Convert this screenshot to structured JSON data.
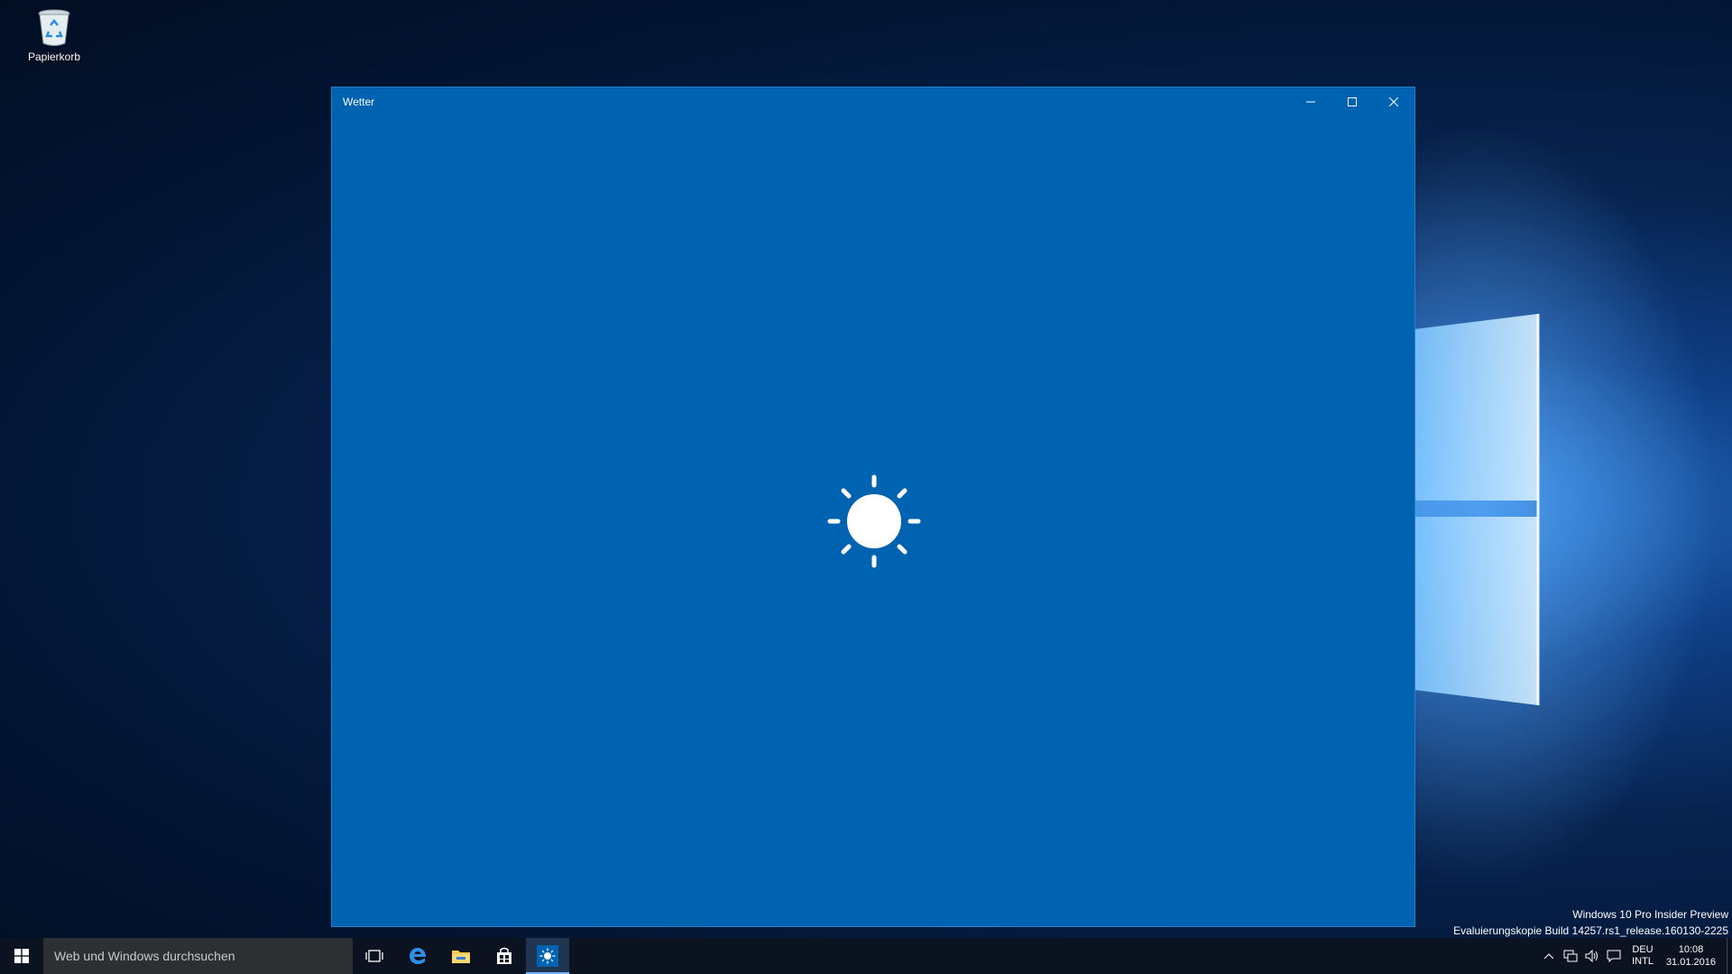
{
  "desktop": {
    "recycle_bin_label": "Papierkorb"
  },
  "window": {
    "title": "Wetter",
    "background": "#0063b1",
    "splash_icon": "sun-icon"
  },
  "watermark": {
    "line1": "Windows 10 Pro Insider Preview",
    "line2": "Evaluierungskopie Build 14257.rs1_release.160130-2225"
  },
  "taskbar": {
    "search_placeholder": "Web und Windows durchsuchen",
    "pinned": [
      "task-view-icon",
      "edge-icon",
      "file-explorer-icon",
      "store-icon",
      "weather-icon"
    ],
    "active_app": "weather-icon",
    "language": {
      "line1": "DEU",
      "line2": "INTL"
    },
    "clock": {
      "time": "10:08",
      "date": "31.01.2016"
    }
  }
}
